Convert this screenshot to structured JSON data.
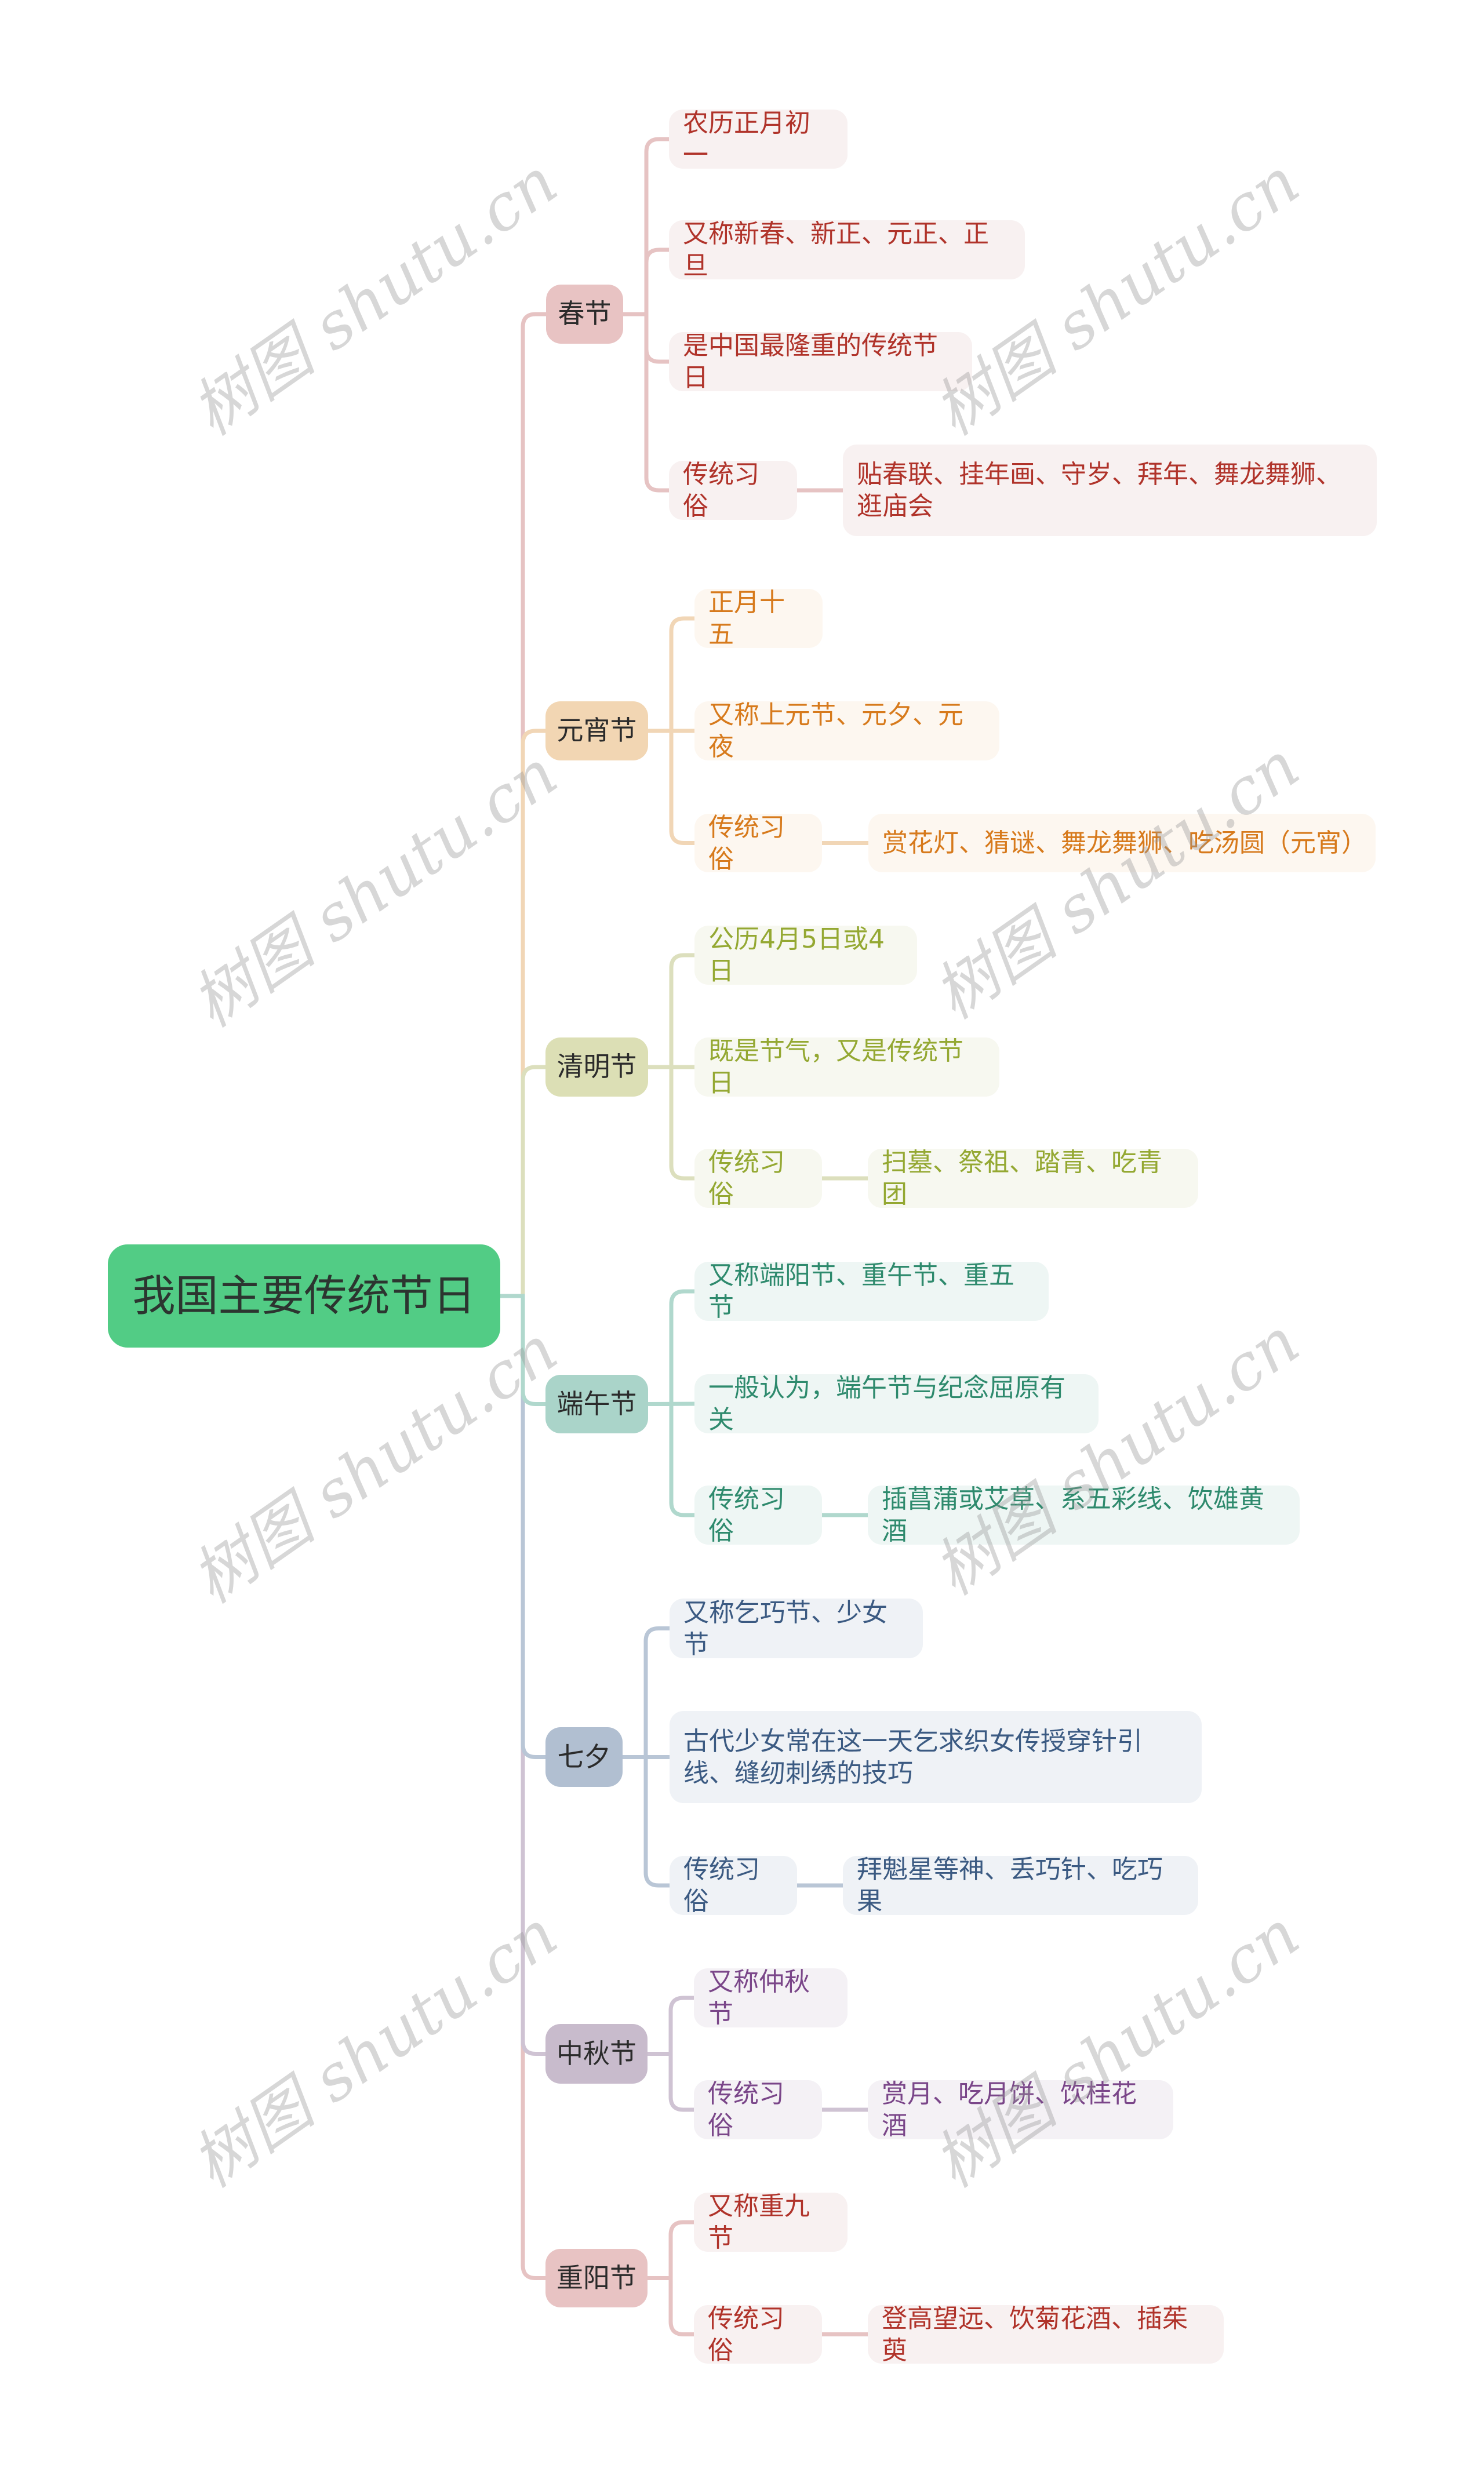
{
  "root": {
    "label": "我国主要传统节日",
    "color": "#52cc85"
  },
  "watermark": "树图 shutu.cn",
  "branches": [
    {
      "label": "春节",
      "node_color": "#e8c3c3",
      "line_color": "#e6c3c3",
      "leaf_bg": "#f8f1f1",
      "text_color": "#b0332a",
      "leaves": [
        {
          "text": "农历正月初一"
        },
        {
          "text": "又称新春、新正、元正、正旦"
        },
        {
          "text": "是中国最隆重的传统节日"
        },
        {
          "text": "传统习俗",
          "detail": "贴春联、挂年画、守岁、拜年、舞龙舞狮、逛庙会"
        }
      ]
    },
    {
      "label": "元宵节",
      "node_color": "#f2d6b3",
      "line_color": "#f1d6b6",
      "leaf_bg": "#fdf7f0",
      "text_color": "#d77a1c",
      "leaves": [
        {
          "text": "正月十五"
        },
        {
          "text": "又称上元节、元夕、元夜"
        },
        {
          "text": "传统习俗",
          "detail": "赏花灯、猜谜、舞龙舞狮、吃汤圆（元宵）"
        }
      ]
    },
    {
      "label": "清明节",
      "node_color": "#dcdfb5",
      "line_color": "#dcdfbd",
      "leaf_bg": "#f7f8f0",
      "text_color": "#94a832",
      "leaves": [
        {
          "text": "公历4月5日或4日"
        },
        {
          "text": "既是节气，又是传统节日"
        },
        {
          "text": "传统习俗",
          "detail": "扫墓、祭祖、踏青、吃青团"
        }
      ]
    },
    {
      "label": "端午节",
      "node_color": "#aad4c9",
      "line_color": "#b0d8cd",
      "leaf_bg": "#eef6f4",
      "text_color": "#2e8a6d",
      "leaves": [
        {
          "text": "又称端阳节、重午节、重五节"
        },
        {
          "text": "一般认为，端午节与纪念屈原有关"
        },
        {
          "text": "传统习俗",
          "detail": "插菖蒲或艾草、系五彩线、饮雄黄酒"
        }
      ]
    },
    {
      "label": "七夕",
      "node_color": "#b1bfd1",
      "line_color": "#b9c6d6",
      "leaf_bg": "#eff2f6",
      "text_color": "#3b5a82",
      "leaves": [
        {
          "text": "又称乞巧节、少女节"
        },
        {
          "text": "古代少女常在这一天乞求织女传授穿针引线、缝纫刺绣的技巧"
        },
        {
          "text": "传统习俗",
          "detail": "拜魁星等神、丢巧针、吃巧果"
        }
      ]
    },
    {
      "label": "中秋节",
      "node_color": "#c8bbcc",
      "line_color": "#cfc3d3",
      "leaf_bg": "#f4f1f5",
      "text_color": "#7a4689",
      "leaves": [
        {
          "text": "又称仲秋节"
        },
        {
          "text": "传统习俗",
          "detail": "赏月、吃月饼、饮桂花酒"
        }
      ]
    },
    {
      "label": "重阳节",
      "node_color": "#e8c3c3",
      "line_color": "#e6c3c3",
      "leaf_bg": "#f8f1f1",
      "text_color": "#b0332a",
      "leaves": [
        {
          "text": "又称重九节"
        },
        {
          "text": "传统习俗",
          "detail": "登高望远、饮菊花酒、插茱萸"
        }
      ]
    }
  ]
}
